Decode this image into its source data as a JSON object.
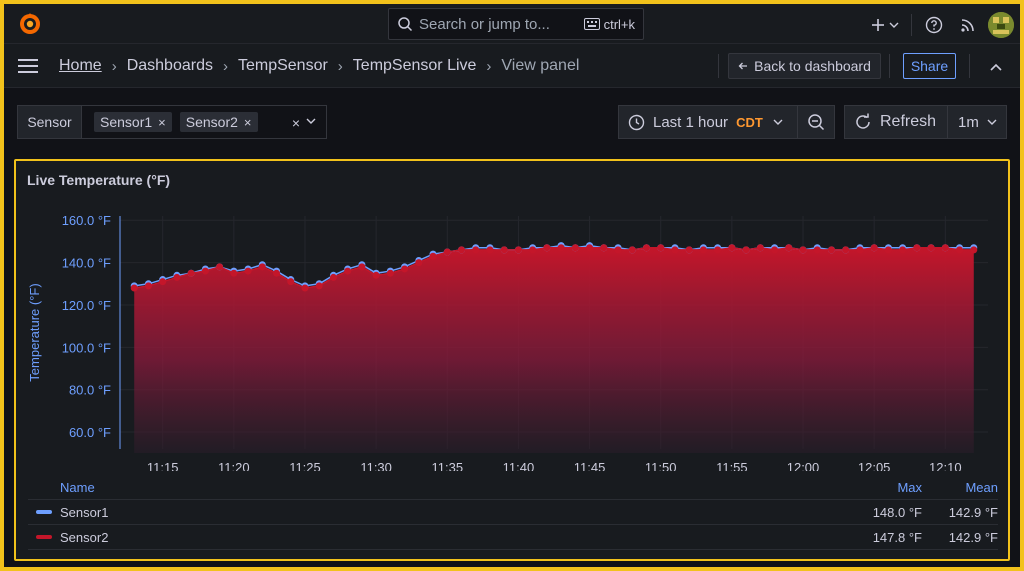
{
  "topbar": {
    "search_placeholder": "Search or jump to...",
    "search_shortcut": "ctrl+k"
  },
  "breadcrumb": {
    "home": "Home",
    "dashboards": "Dashboards",
    "folder": "TempSensor",
    "dashboard": "TempSensor Live",
    "current": "View panel",
    "separator": "›"
  },
  "actions": {
    "back_label": "Back to dashboard",
    "share_label": "Share"
  },
  "variables": {
    "label": "Sensor",
    "selected": [
      "Sensor1",
      "Sensor2"
    ],
    "remove_glyph": "×"
  },
  "time": {
    "range_label": "Last 1 hour",
    "timezone": "CDT",
    "refresh_label": "Refresh",
    "interval": "1m"
  },
  "panel": {
    "title": "Live Temperature (°F)"
  },
  "colors": {
    "sensor1": "#6e9fff",
    "sensor2": "#c4162a",
    "accent": "#f2c21b",
    "tz": "#ff9830"
  },
  "legend": {
    "name_header": "Name",
    "max_header": "Max",
    "mean_header": "Mean",
    "rows": [
      {
        "name": "Sensor1",
        "max": "148.0 °F",
        "mean": "142.9 °F"
      },
      {
        "name": "Sensor2",
        "max": "147.8 °F",
        "mean": "142.9 °F"
      }
    ]
  },
  "chart_data": {
    "type": "area",
    "title": "Live Temperature (°F)",
    "ylabel": "Temperature (°F)",
    "xlabel": "",
    "y_unit": "°F",
    "ylim": [
      52,
      162
    ],
    "y_ticks": [
      "60.0 °F",
      "80.0 °F",
      "100.0 °F",
      "120.0 °F",
      "140.0 °F",
      "160.0 °F"
    ],
    "y_tick_values": [
      60,
      80,
      100,
      120,
      140,
      160
    ],
    "x_start": "11:12",
    "x_end": "12:13",
    "x_ticks": [
      "11:15",
      "11:20",
      "11:25",
      "11:30",
      "11:35",
      "11:40",
      "11:45",
      "11:50",
      "11:55",
      "12:00",
      "12:05",
      "12:10"
    ],
    "grid": true,
    "legend_placement": "bottom",
    "x": [
      "11:13",
      "11:14",
      "11:15",
      "11:16",
      "11:17",
      "11:18",
      "11:19",
      "11:20",
      "11:21",
      "11:22",
      "11:23",
      "11:24",
      "11:25",
      "11:26",
      "11:27",
      "11:28",
      "11:29",
      "11:30",
      "11:31",
      "11:32",
      "11:33",
      "11:34",
      "11:35",
      "11:36",
      "11:37",
      "11:38",
      "11:39",
      "11:40",
      "11:41",
      "11:42",
      "11:43",
      "11:44",
      "11:45",
      "11:46",
      "11:47",
      "11:48",
      "11:49",
      "11:50",
      "11:51",
      "11:52",
      "11:53",
      "11:54",
      "11:55",
      "11:56",
      "11:57",
      "11:58",
      "11:59",
      "12:00",
      "12:01",
      "12:02",
      "12:03",
      "12:04",
      "12:05",
      "12:06",
      "12:07",
      "12:08",
      "12:09",
      "12:10",
      "12:11",
      "12:12"
    ],
    "series": [
      {
        "name": "Sensor1",
        "values": [
          129,
          130,
          132,
          134,
          135,
          137,
          138,
          136,
          137,
          139,
          136,
          132,
          129,
          130,
          134,
          137,
          139,
          135,
          136,
          138,
          141,
          144,
          145,
          146,
          147,
          147,
          146,
          146,
          147,
          147,
          148,
          147,
          148,
          147,
          147,
          146,
          147,
          147,
          147,
          146,
          147,
          147,
          147,
          146,
          147,
          147,
          147,
          146,
          147,
          146,
          146,
          147,
          147,
          147,
          147,
          147,
          147,
          147,
          147,
          147
        ]
      },
      {
        "name": "Sensor2",
        "values": [
          128,
          129,
          131,
          133,
          135,
          136,
          138,
          135,
          136,
          138,
          135,
          131,
          128,
          129,
          133,
          136,
          138,
          134,
          135,
          137,
          140,
          143,
          145,
          146,
          146,
          146,
          146,
          146,
          146,
          147,
          147,
          147,
          147,
          147,
          146,
          146,
          147,
          147,
          146,
          146,
          146,
          146,
          147,
          146,
          147,
          146,
          147,
          146,
          146,
          146,
          146,
          146,
          147,
          146,
          146,
          147,
          147,
          147,
          146,
          146
        ]
      }
    ]
  }
}
